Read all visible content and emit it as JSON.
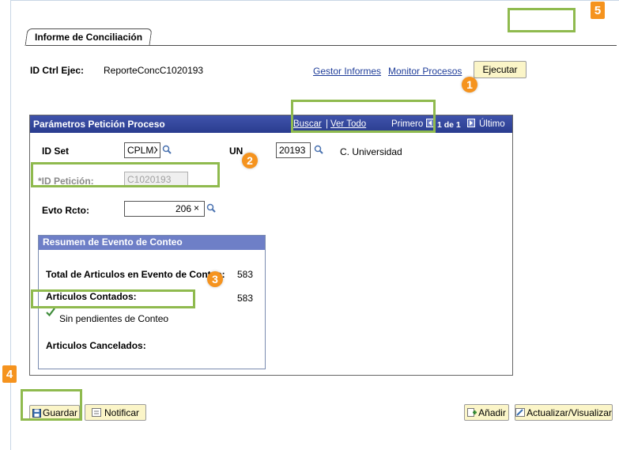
{
  "tab": {
    "label": "Informe de Conciliación"
  },
  "header": {
    "run_control_label": "ID Ctrl Ejec:",
    "run_control_value": "ReporteConcC1020193",
    "link_report_manager": "Gestor Informes",
    "link_process_monitor": "Monitor Procesos",
    "run_button": "Ejecutar"
  },
  "params": {
    "title": "Parámetros Petición Proceso",
    "nav_find": "Buscar",
    "nav_sep": "|",
    "nav_view_all": "Ver Todo",
    "nav_first": "Primero",
    "nav_count": "1 de 1",
    "nav_last": "Último",
    "setid_label": "ID Set",
    "setid_value": "CPLMX",
    "unit_label": "UN",
    "unit_value": "20193",
    "unit_desc": "C. Universidad",
    "request_label": "*ID Petición:",
    "request_value": "C1020193",
    "event_label": "Evto Rcto:",
    "event_value": "206"
  },
  "summary": {
    "title": "Resumen de Evento de Conteo",
    "total_label": "Total de Articulos en Evento de Conteo:",
    "total_value": "583",
    "counted_label": "Articulos Contados:",
    "counted_value": "583",
    "status_text": "Sin pendientes de Conteo",
    "cancelled_label": "Articulos Cancelados:"
  },
  "footer": {
    "save_button": "Guardar",
    "notify_button": "Notificar",
    "add_button": "Añadir",
    "update_button": "Actualizar/Visualizar"
  },
  "callouts": {
    "n1": "1",
    "n2": "2",
    "n3": "3",
    "n4": "4",
    "n5": "5"
  },
  "colors": {
    "highlight": "#8fba4e",
    "badge": "#f5931e",
    "group_header": "#2f4298",
    "link": "#1f3d99",
    "button_bg": "#fbf5c8"
  }
}
